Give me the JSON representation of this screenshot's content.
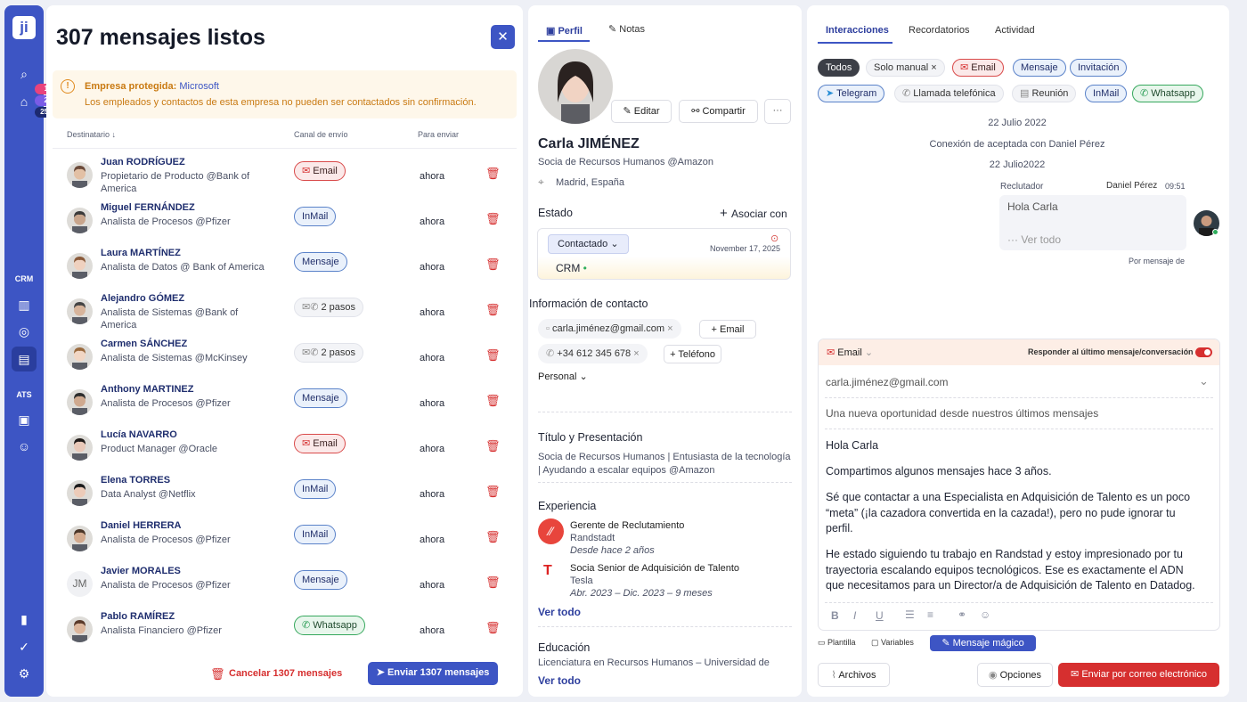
{
  "sidebar": {
    "logo": "ji",
    "badges": [
      "1",
      "2",
      "25"
    ],
    "crm_label": "CRM",
    "ats_label": "ATS"
  },
  "main": {
    "title": "307 mensajes listos",
    "warning": {
      "title": "Empresa protegida:",
      "company": "Microsoft",
      "text": "Los empleados y contactos de esta empresa no pueden ser contactados sin confirmación."
    },
    "columns": {
      "recipient": "Destinatario ↓",
      "channel": "Canal de envío",
      "send": "Para enviar"
    },
    "rows": [
      {
        "name": "Juan RODRÍGUEZ",
        "subtitle": "Propietario de Producto @Bank of America",
        "channel": "Email",
        "kind": "email",
        "when": "ahora",
        "initials": ""
      },
      {
        "name": "Miguel FERNÁNDEZ",
        "subtitle": "Analista de Procesos @Pfizer",
        "channel": "InMail",
        "kind": "blue",
        "when": "ahora",
        "initials": ""
      },
      {
        "name": "Laura MARTÍNEZ",
        "subtitle": "Analista de Datos @ Bank of America",
        "channel": "Mensaje",
        "kind": "blue",
        "when": "ahora",
        "initials": ""
      },
      {
        "name": "Alejandro GÓMEZ",
        "subtitle": "Analista de Sistemas @Bank of America",
        "channel": "2 pasos",
        "kind": "steps",
        "when": "ahora",
        "initials": ""
      },
      {
        "name": "Carmen SÁNCHEZ",
        "subtitle": "Analista de Sistemas @McKinsey",
        "channel": "2 pasos",
        "kind": "steps",
        "when": "ahora",
        "initials": ""
      },
      {
        "name": "Anthony MARTINEZ",
        "subtitle": "Analista de Procesos @Pfizer",
        "channel": "Mensaje",
        "kind": "blue",
        "when": "ahora",
        "initials": ""
      },
      {
        "name": "Lucía NAVARRO",
        "subtitle": "Product Manager @Oracle",
        "channel": "Email",
        "kind": "email",
        "when": "ahora",
        "initials": ""
      },
      {
        "name": "Elena TORRES",
        "subtitle": "Data Analyst @Netflix",
        "channel": "InMail",
        "kind": "blue",
        "when": "ahora",
        "initials": ""
      },
      {
        "name": "Daniel HERRERA",
        "subtitle": "Analista de Procesos @Pfizer",
        "channel": "InMail",
        "kind": "blue",
        "when": "ahora",
        "initials": ""
      },
      {
        "name": "Javier MORALES",
        "subtitle": "Analista de Procesos @Pfizer",
        "channel": "Mensaje",
        "kind": "blue",
        "when": "ahora",
        "initials": "JM"
      },
      {
        "name": "Pablo RAMÍREZ",
        "subtitle": "Analista Financiero @Pfizer",
        "channel": "Whatsapp",
        "kind": "green",
        "when": "ahora",
        "initials": ""
      }
    ],
    "cancel": "Cancelar 1307 mensajes",
    "send": "Enviar 1307 mensajes"
  },
  "profile": {
    "tabs": [
      "Perfil",
      "Notas"
    ],
    "edit": "Editar",
    "share": "Compartir",
    "more": "···",
    "name": "Carla JIMÉNEZ",
    "headline": "Socia de Recursos Humanos @Amazon",
    "location": "Madrid, España",
    "state_label": "Estado",
    "associate": "Asociar con",
    "status": "Contactado",
    "status_date": "November 17, 2025",
    "crm": "CRM",
    "contact_title": "Información de contacto",
    "email": "carla.jiménez@gmail.com",
    "email_btn": "Email",
    "phone": "+34 612 345 678",
    "phone_btn": "Teléfono",
    "personal": "Personal",
    "title_section": "Título y Presentación",
    "title_text": "Socia de Recursos Humanos | Entusiasta de la tecnología | Ayudando a escalar equipos @Amazon",
    "experience_title": "Experiencia",
    "experience": [
      {
        "role": "Gerente de Reclutamiento",
        "company": "Randstadt",
        "dates": "Desde hace 2 años"
      },
      {
        "role": "Socia Senior de Adquisición de Talento",
        "company": "Tesla",
        "dates": "Abr. 2023 – Dic. 2023 – 9 meses"
      }
    ],
    "see_all": "Ver todo",
    "education_title": "Educación",
    "education_text": "Licenciatura en Recursos Humanos – Universidad de Navarra",
    "see_all2": "Ver todo"
  },
  "interactions": {
    "tabs": [
      "Interacciones",
      "Recordatorios",
      "Actividad"
    ],
    "filters": [
      {
        "label": "Todos",
        "kind": "dark"
      },
      {
        "label": "Solo manual ×",
        "kind": "gray"
      },
      {
        "label": "Email",
        "kind": "email"
      },
      {
        "label": "Mensaje",
        "kind": "blue"
      },
      {
        "label": "Invitación",
        "kind": "blue"
      }
    ],
    "filters2": [
      {
        "label": "Telegram",
        "kind": "blue"
      },
      {
        "label": "Llamada telefónica",
        "kind": "gray"
      },
      {
        "label": "Reunión",
        "kind": "gray"
      },
      {
        "label": "InMail",
        "kind": "blue"
      },
      {
        "label": "Whatsapp",
        "kind": "green"
      }
    ],
    "date1": "22 Julio 2022",
    "event": "Conexión de aceptada con Daniel Pérez",
    "date2": "22 Julio2022",
    "msg": {
      "role": "Reclutador",
      "sender": "Daniel Pérez",
      "time": "09:51",
      "text": "Hola Carla",
      "see_all": "Ver todo",
      "by": "Por mensaje de"
    }
  },
  "composer": {
    "channel": "Email",
    "reply_label": "Responder al último mensaje/conversación",
    "to": "carla.jiménez@gmail.com",
    "subject": "Una nueva oportunidad desde nuestros últimos mensajes",
    "p1": "Hola Carla",
    "p2": "Compartimos algunos mensajes hace 3 años.",
    "p3": "Sé que contactar a una Especialista en Adquisición de Talento es un poco “meta” (¡la cazadora convertida en la cazada!), pero no pude ignorar tu perfil.",
    "p4": "He estado siguiendo tu trabajo en Randstad y estoy impresionado por tu trayectoria escalando equipos tecnológicos. Ese es exactamente el ADN que necesitamos para un Director/a de Adquisición de Talento en Datadog.",
    "template": "Plantilla",
    "variables": "Variables",
    "magic": "Mensaje mágico",
    "files": "Archivos",
    "options": "Opciones",
    "send_email": "Enviar por correo electrónico"
  },
  "colors": {
    "accent": "#3d55c4",
    "danger": "#d62f2f",
    "warning": "#c97a12"
  }
}
